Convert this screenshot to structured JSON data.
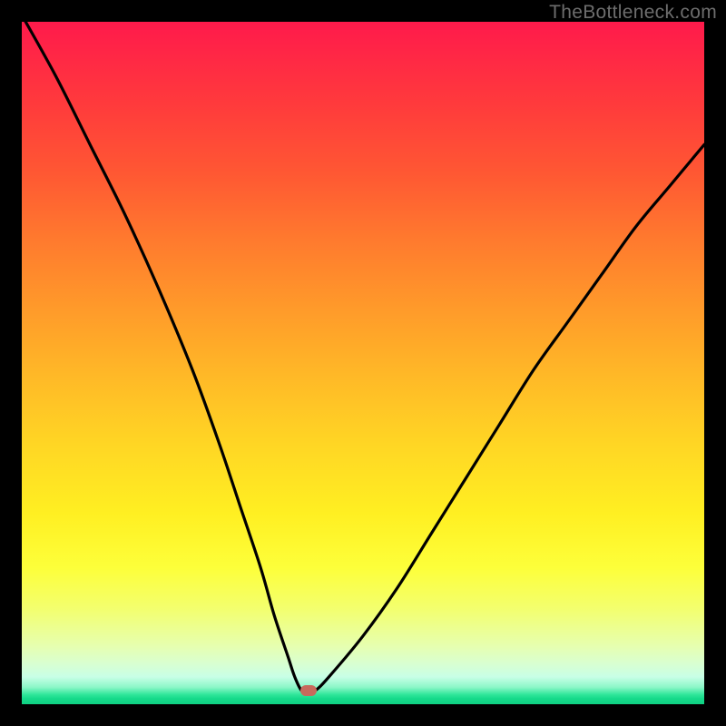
{
  "watermark": "TheBottleneck.com",
  "colors": {
    "frame": "#000000",
    "curve": "#000000",
    "marker": "#c76a5c"
  },
  "chart_data": {
    "type": "line",
    "title": "",
    "xlabel": "",
    "ylabel": "",
    "xlim": [
      0,
      100
    ],
    "ylim": [
      0,
      100
    ],
    "grid": false,
    "legend": false,
    "annotations": [
      "TheBottleneck.com"
    ],
    "marker": {
      "x": 42,
      "y": 2
    },
    "series": [
      {
        "name": "bottleneck-curve",
        "x": [
          0,
          5,
          10,
          15,
          20,
          25,
          29,
          32,
          35,
          37,
          39,
          40,
          41,
          42,
          43,
          45,
          50,
          55,
          60,
          65,
          70,
          75,
          80,
          85,
          90,
          95,
          100
        ],
        "values": [
          101,
          92,
          82,
          72,
          61,
          49,
          38,
          29,
          20,
          13,
          7,
          4,
          2,
          2,
          2,
          4,
          10,
          17,
          25,
          33,
          41,
          49,
          56,
          63,
          70,
          76,
          82
        ]
      }
    ],
    "background_gradient": {
      "top": "#ff1a4b",
      "mid1": "#ff9a2a",
      "mid2": "#ffef22",
      "bottom": "#0fd184"
    }
  }
}
